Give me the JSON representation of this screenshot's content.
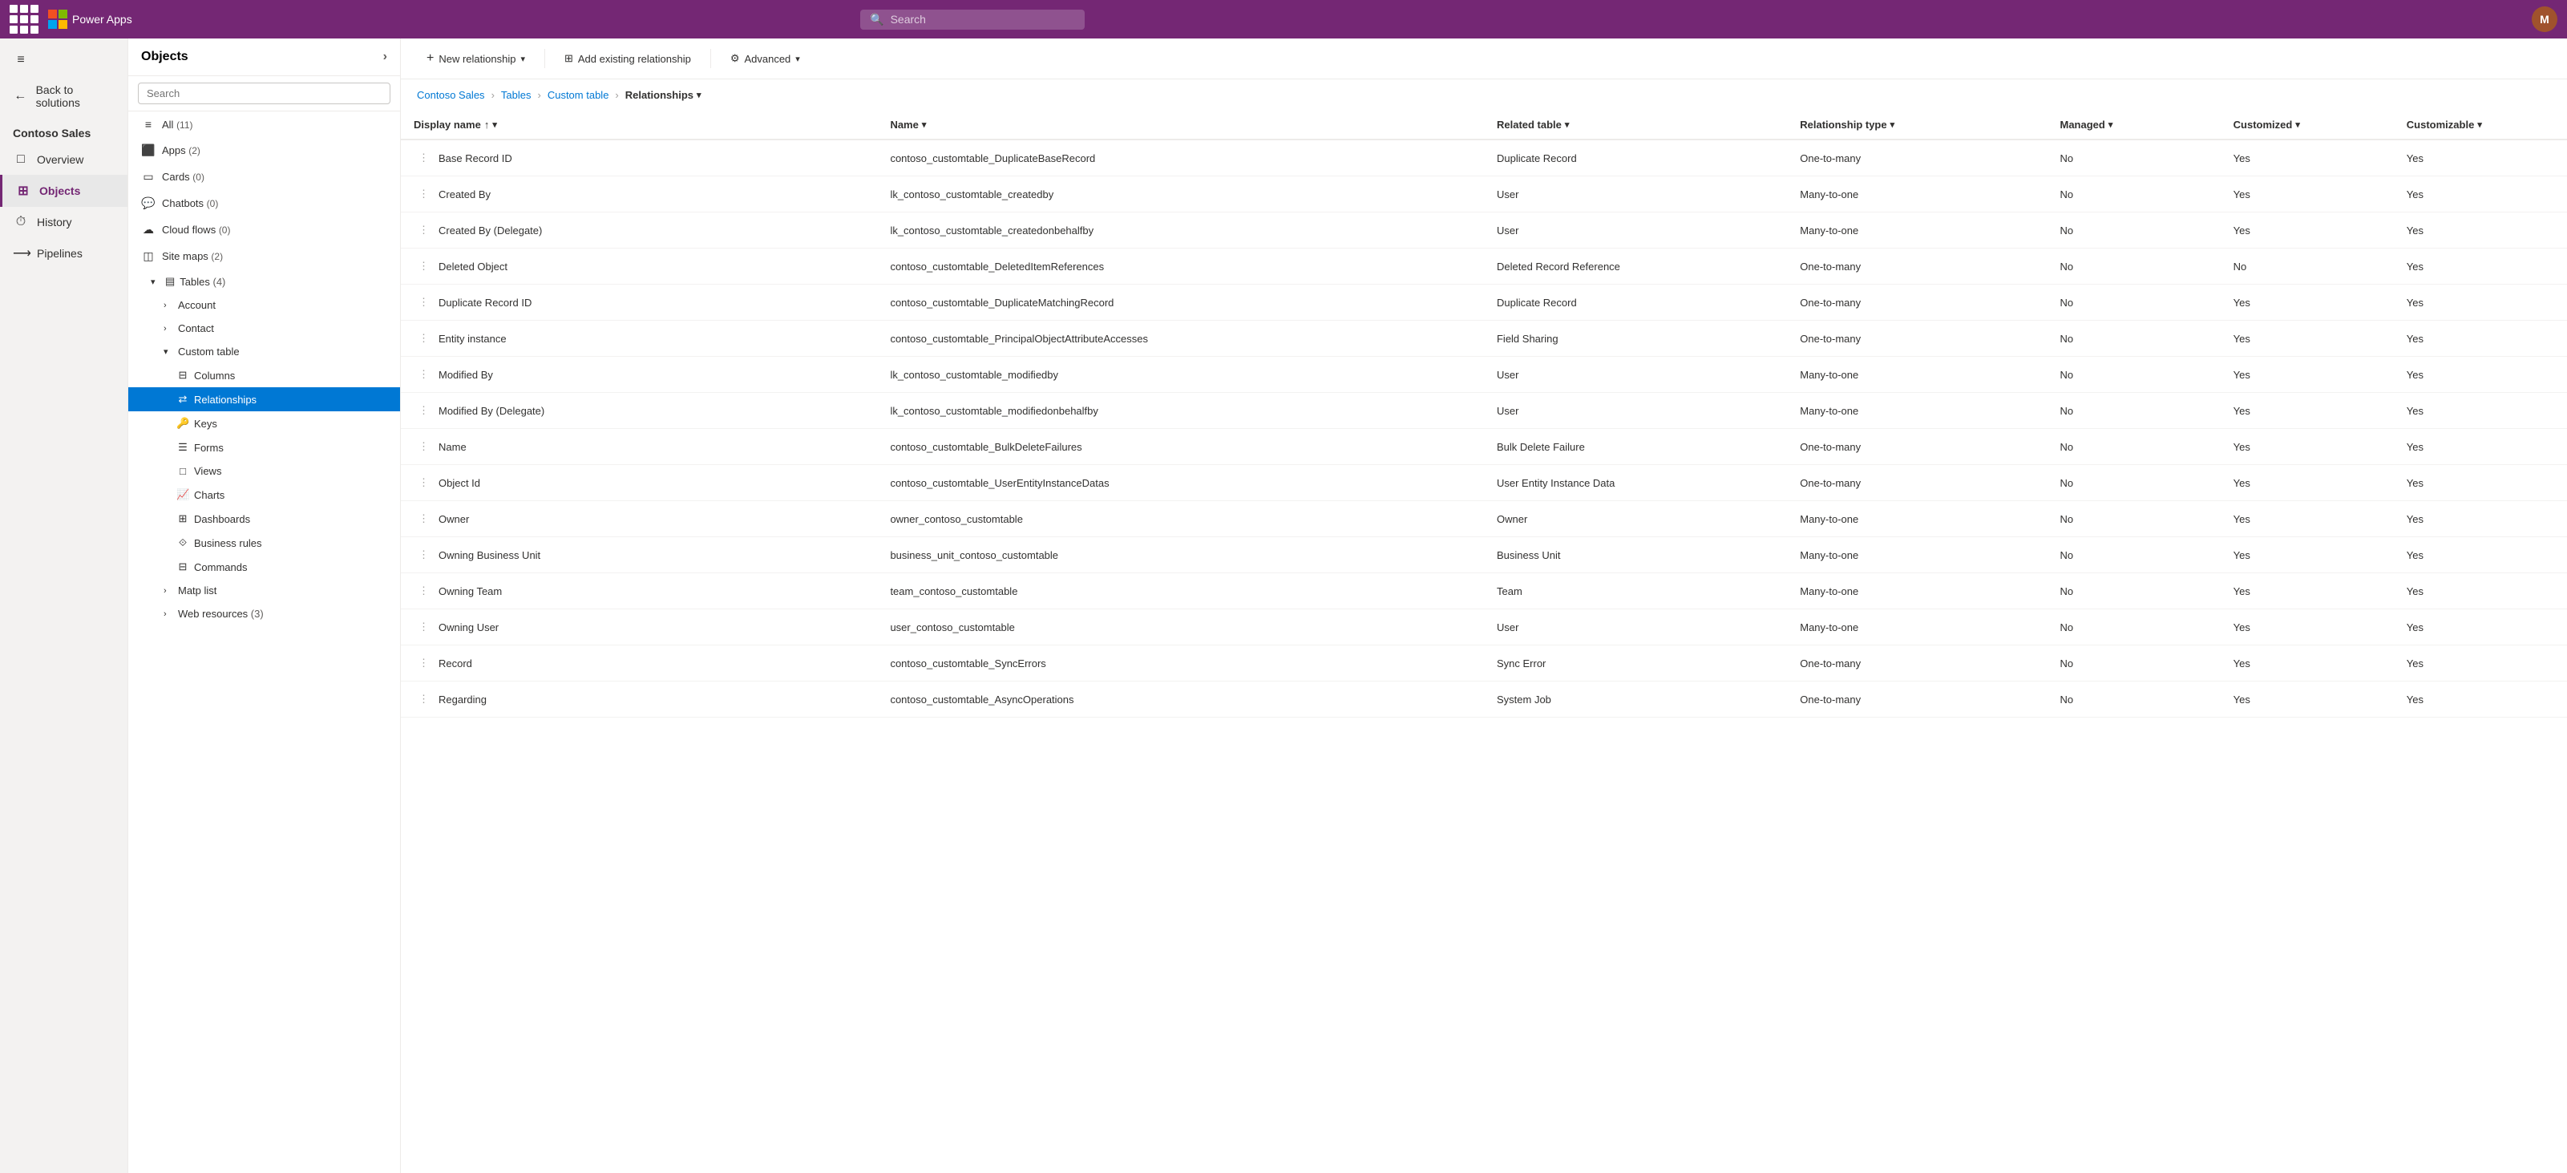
{
  "topbar": {
    "app_name": "Power Apps",
    "search_placeholder": "Search",
    "avatar_initials": "M"
  },
  "left_nav": {
    "items": [
      {
        "id": "hamburger",
        "icon": "≡",
        "label": ""
      },
      {
        "id": "back",
        "icon": "←",
        "label": "Back to solutions"
      },
      {
        "id": "contoso",
        "label": "Contoso Sales"
      },
      {
        "id": "overview",
        "icon": "□",
        "label": "Overview"
      },
      {
        "id": "objects",
        "icon": "⊞",
        "label": "Objects",
        "active": true
      },
      {
        "id": "history",
        "icon": "⏱",
        "label": "History"
      },
      {
        "id": "pipelines",
        "icon": "⟶",
        "label": "Pipelines"
      }
    ]
  },
  "sidebar": {
    "title": "Objects",
    "search_placeholder": "Search",
    "items": [
      {
        "icon": "≡",
        "label": "All",
        "count": "(11)"
      },
      {
        "icon": "⬛",
        "label": "Apps",
        "count": "(2)"
      },
      {
        "icon": "▭",
        "label": "Cards",
        "count": "(0)"
      },
      {
        "icon": "💬",
        "label": "Chatbots",
        "count": "(0)"
      },
      {
        "icon": "☁",
        "label": "Cloud flows",
        "count": "(0)"
      },
      {
        "icon": "◫",
        "label": "Site maps",
        "count": "(2)"
      }
    ],
    "tables_label": "Tables",
    "tables_count": "(4)",
    "tables_items": [
      {
        "label": "Account",
        "expanded": false
      },
      {
        "label": "Contact",
        "expanded": false
      },
      {
        "label": "Custom table",
        "expanded": true,
        "children": [
          {
            "label": "Columns"
          },
          {
            "label": "Relationships",
            "active": true
          },
          {
            "label": "Keys"
          },
          {
            "label": "Forms"
          },
          {
            "label": "Views"
          },
          {
            "label": "Charts"
          },
          {
            "label": "Dashboards"
          },
          {
            "label": "Business rules"
          },
          {
            "label": "Commands"
          }
        ]
      },
      {
        "label": "Matp list",
        "expanded": false
      },
      {
        "label": "Web resources",
        "count": "(3)",
        "expanded": false
      }
    ]
  },
  "toolbar": {
    "new_relationship": "New relationship",
    "add_existing": "Add existing relationship",
    "advanced": "Advanced"
  },
  "breadcrumb": [
    {
      "label": "Contoso Sales",
      "link": true
    },
    {
      "label": "Tables",
      "link": true
    },
    {
      "label": "Custom table",
      "link": true
    },
    {
      "label": "Relationships",
      "link": false,
      "current": true
    }
  ],
  "table": {
    "columns": [
      {
        "key": "display_name",
        "label": "Display name",
        "sort": "asc"
      },
      {
        "key": "name",
        "label": "Name",
        "sort": null
      },
      {
        "key": "related_table",
        "label": "Related table",
        "sort": null
      },
      {
        "key": "relationship_type",
        "label": "Relationship type",
        "sort": null
      },
      {
        "key": "managed",
        "label": "Managed",
        "sort": null
      },
      {
        "key": "customized",
        "label": "Customized",
        "sort": null
      },
      {
        "key": "customizable",
        "label": "Customizable",
        "sort": null
      }
    ],
    "rows": [
      {
        "display_name": "Base Record ID",
        "name": "contoso_customtable_DuplicateBaseRecord",
        "related_table": "Duplicate Record",
        "relationship_type": "One-to-many",
        "managed": "No",
        "customized": "Yes",
        "customizable": "Yes"
      },
      {
        "display_name": "Created By",
        "name": "lk_contoso_customtable_createdby",
        "related_table": "User",
        "relationship_type": "Many-to-one",
        "managed": "No",
        "customized": "Yes",
        "customizable": "Yes"
      },
      {
        "display_name": "Created By (Delegate)",
        "name": "lk_contoso_customtable_createdonbehalfby",
        "related_table": "User",
        "relationship_type": "Many-to-one",
        "managed": "No",
        "customized": "Yes",
        "customizable": "Yes"
      },
      {
        "display_name": "Deleted Object",
        "name": "contoso_customtable_DeletedItemReferences",
        "related_table": "Deleted Record Reference",
        "relationship_type": "One-to-many",
        "managed": "No",
        "customized": "No",
        "customizable": "Yes"
      },
      {
        "display_name": "Duplicate Record ID",
        "name": "contoso_customtable_DuplicateMatchingRecord",
        "related_table": "Duplicate Record",
        "relationship_type": "One-to-many",
        "managed": "No",
        "customized": "Yes",
        "customizable": "Yes"
      },
      {
        "display_name": "Entity instance",
        "name": "contoso_customtable_PrincipalObjectAttributeAccesses",
        "related_table": "Field Sharing",
        "relationship_type": "One-to-many",
        "managed": "No",
        "customized": "Yes",
        "customizable": "Yes"
      },
      {
        "display_name": "Modified By",
        "name": "lk_contoso_customtable_modifiedby",
        "related_table": "User",
        "relationship_type": "Many-to-one",
        "managed": "No",
        "customized": "Yes",
        "customizable": "Yes"
      },
      {
        "display_name": "Modified By (Delegate)",
        "name": "lk_contoso_customtable_modifiedonbehalfby",
        "related_table": "User",
        "relationship_type": "Many-to-one",
        "managed": "No",
        "customized": "Yes",
        "customizable": "Yes"
      },
      {
        "display_name": "Name",
        "name": "contoso_customtable_BulkDeleteFailures",
        "related_table": "Bulk Delete Failure",
        "relationship_type": "One-to-many",
        "managed": "No",
        "customized": "Yes",
        "customizable": "Yes"
      },
      {
        "display_name": "Object Id",
        "name": "contoso_customtable_UserEntityInstanceDatas",
        "related_table": "User Entity Instance Data",
        "relationship_type": "One-to-many",
        "managed": "No",
        "customized": "Yes",
        "customizable": "Yes"
      },
      {
        "display_name": "Owner",
        "name": "owner_contoso_customtable",
        "related_table": "Owner",
        "relationship_type": "Many-to-one",
        "managed": "No",
        "customized": "Yes",
        "customizable": "Yes"
      },
      {
        "display_name": "Owning Business Unit",
        "name": "business_unit_contoso_customtable",
        "related_table": "Business Unit",
        "relationship_type": "Many-to-one",
        "managed": "No",
        "customized": "Yes",
        "customizable": "Yes"
      },
      {
        "display_name": "Owning Team",
        "name": "team_contoso_customtable",
        "related_table": "Team",
        "relationship_type": "Many-to-one",
        "managed": "No",
        "customized": "Yes",
        "customizable": "Yes"
      },
      {
        "display_name": "Owning User",
        "name": "user_contoso_customtable",
        "related_table": "User",
        "relationship_type": "Many-to-one",
        "managed": "No",
        "customized": "Yes",
        "customizable": "Yes"
      },
      {
        "display_name": "Record",
        "name": "contoso_customtable_SyncErrors",
        "related_table": "Sync Error",
        "relationship_type": "One-to-many",
        "managed": "No",
        "customized": "Yes",
        "customizable": "Yes"
      },
      {
        "display_name": "Regarding",
        "name": "contoso_customtable_AsyncOperations",
        "related_table": "System Job",
        "relationship_type": "One-to-many",
        "managed": "No",
        "customized": "Yes",
        "customizable": "Yes"
      }
    ]
  }
}
